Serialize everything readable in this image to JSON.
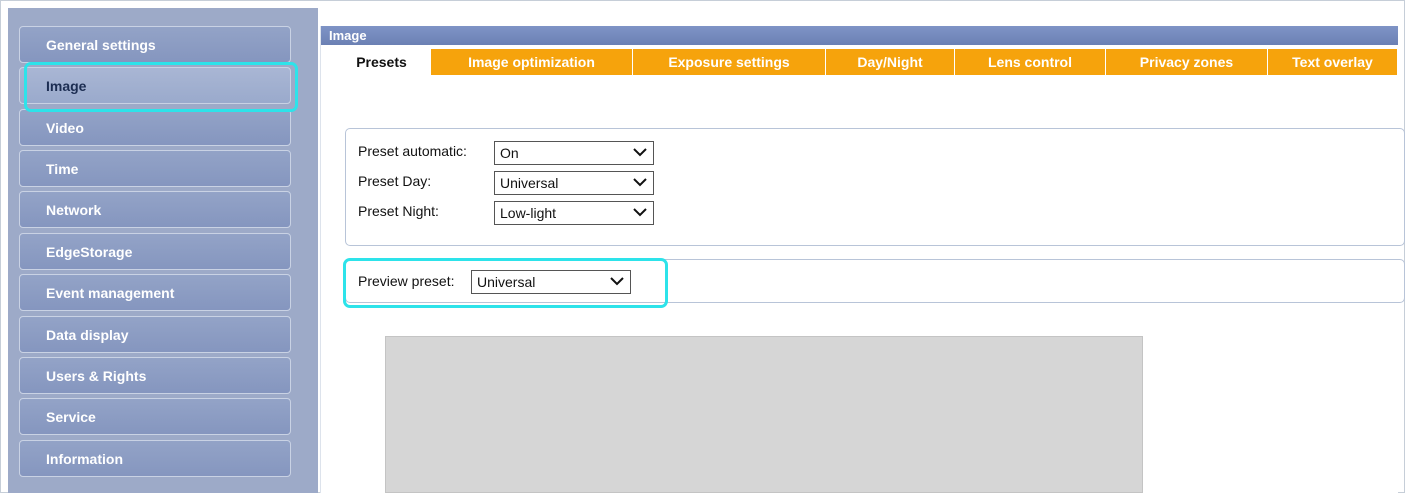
{
  "sidebar": {
    "items": [
      {
        "label": "General settings"
      },
      {
        "label": "Image",
        "active": true
      },
      {
        "label": "Video"
      },
      {
        "label": "Time"
      },
      {
        "label": "Network"
      },
      {
        "label": "EdgeStorage"
      },
      {
        "label": "Event management"
      },
      {
        "label": "Data display"
      },
      {
        "label": "Users & Rights"
      },
      {
        "label": "Service"
      },
      {
        "label": "Information"
      }
    ]
  },
  "main": {
    "title": "Image",
    "tabs": [
      {
        "label": "Presets",
        "active": true
      },
      {
        "label": "Image optimization"
      },
      {
        "label": "Exposure settings"
      },
      {
        "label": "Day/Night"
      },
      {
        "label": "Lens control"
      },
      {
        "label": "Privacy zones"
      },
      {
        "label": "Text overlay"
      }
    ],
    "presets": {
      "automatic_label": "Preset automatic:",
      "automatic_value": "On",
      "day_label": "Preset Day:",
      "day_value": "Universal",
      "night_label": "Preset Night:",
      "night_value": "Low-light"
    },
    "preview": {
      "label": "Preview preset:",
      "value": "Universal"
    }
  },
  "colors": {
    "tab_orange": "#f6a30c",
    "sidebar_bg": "#9daac8",
    "header_blue": "#7489bd",
    "highlight": "#2de3ea"
  }
}
